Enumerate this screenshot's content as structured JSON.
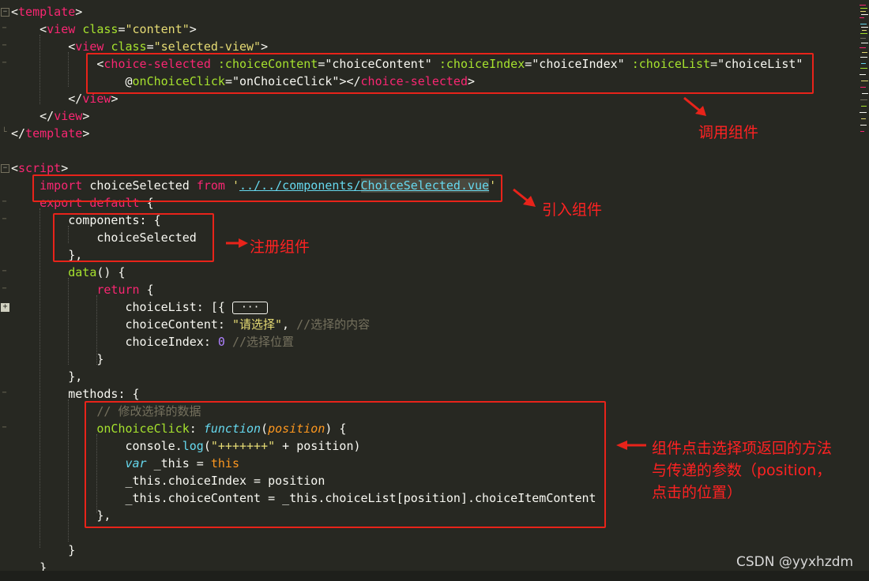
{
  "code": {
    "template_open": "template",
    "view": "view",
    "class_attr": "class",
    "content_val": "\"content\"",
    "selected_view_val": "\"selected-view\"",
    "choice_selected_tag": "choice-selected",
    "attr_choice_content": ":choiceContent",
    "val_choice_content": "\"choiceContent\"",
    "attr_choice_index": ":choiceIndex",
    "val_choice_index": "\"choiceIndex\"",
    "attr_choice_list": ":choiceList",
    "val_choice_list": "\"choiceList\"",
    "at_sign": "@",
    "attr_on_click": "onChoiceClick",
    "val_on_click": "\"onChoiceClick\"",
    "script_tag": "script",
    "kw_import": "import",
    "import_name": "choiceSelected",
    "kw_from": "from",
    "import_path_prefix": "../../components/",
    "import_path_file": "ChoiceSelected.vue",
    "kw_export": "export",
    "kw_default": "default",
    "components_key": "components: {",
    "components_item": "choiceSelected",
    "close_brace_comma": "},",
    "data_fn": "data",
    "data_rest": "() {",
    "kw_return": "return",
    "choice_list_key": "choiceList: [{",
    "fold_ellipsis": "···",
    "choice_content_key": "choiceContent: ",
    "choice_content_val": "\"请选择\"",
    "comment_content": "//选择的内容",
    "choice_index_key": "choiceIndex: ",
    "choice_index_val": "0",
    "comment_index": "//选择位置",
    "methods_key": "methods: {",
    "comment_modify": "// 修改选择的数据",
    "on_choice_click": "onChoiceClick",
    "kw_function": "function",
    "param_position": "position",
    "console": "console",
    "log": "log",
    "log_str": "\"+++++++\"",
    "plus_position": " + position)",
    "kw_var": "var",
    "this_var": " _this = ",
    "kw_this": "this",
    "assign_index": "_this.choiceIndex = position",
    "assign_content": "_this.choiceContent = _this.choiceList[position].choiceItemContent"
  },
  "annotations": {
    "call_component": "调用组件",
    "import_component": "引入组件",
    "register_component": "注册组件",
    "callback_line1": "组件点击选择项返回的方法",
    "callback_line2": "与传递的参数（position，",
    "callback_line3": "点击的位置）"
  },
  "watermark": "CSDN @yyxhzdm",
  "colors": {
    "background": "#272822",
    "annotation_red": "#e8231a",
    "tag_pink": "#f92672",
    "attr_green": "#a6e22e",
    "string_yellow": "#e6db74",
    "keyword_blue": "#66d9ef",
    "comment_gray": "#75715e"
  }
}
